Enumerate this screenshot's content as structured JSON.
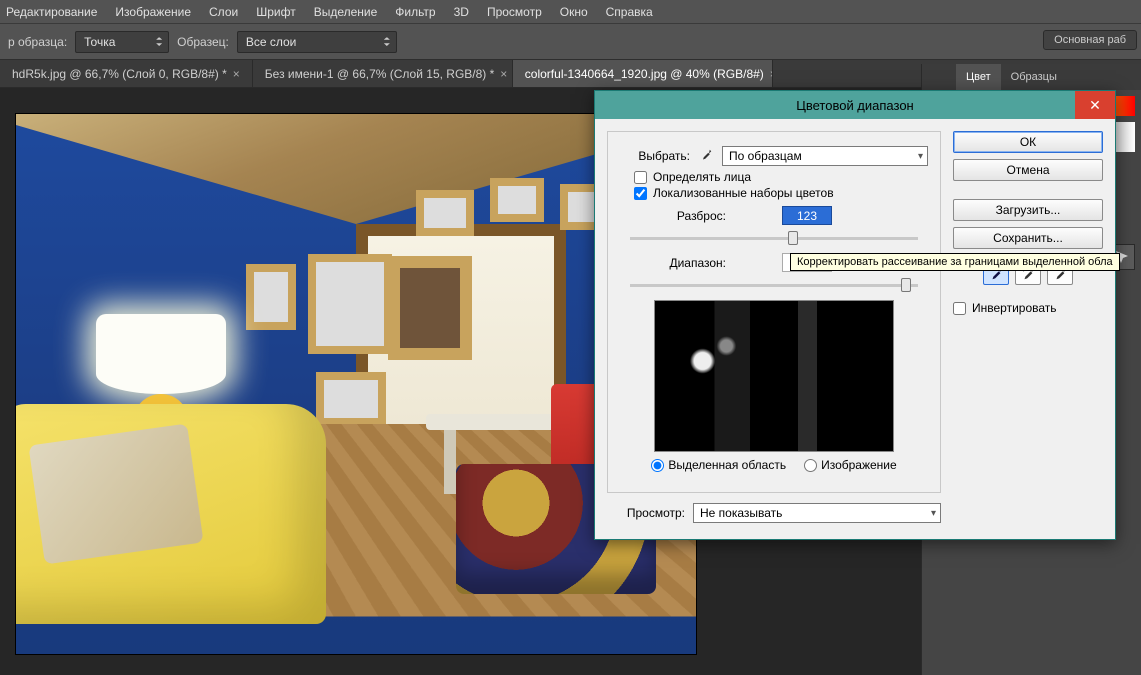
{
  "menu": {
    "items": [
      "Редактирование",
      "Изображение",
      "Слои",
      "Шрифт",
      "Выделение",
      "Фильтр",
      "3D",
      "Просмотр",
      "Окно",
      "Справка"
    ]
  },
  "options": {
    "sample_label": "р образца:",
    "sample_value": "Точка",
    "sample_from_label": "Образец:",
    "sample_from_value": "Все слои",
    "right_button": "Основная раб"
  },
  "tabs": [
    {
      "label": "hdR5k.jpg @ 66,7% (Слой 0, RGB/8#) *",
      "active": false
    },
    {
      "label": "Без имени-1 @ 66,7% (Слой 15, RGB/8) *",
      "active": false
    },
    {
      "label": "colorful-1340664_1920.jpg @ 40% (RGB/8#)",
      "active": true
    }
  ],
  "rightpanel": {
    "tabs": [
      "Цвет",
      "Образцы"
    ]
  },
  "dialog": {
    "title": "Цветовой диапазон",
    "select_label": "Выбрать:",
    "select_value": "По образцам",
    "detect_faces": "Определять лица",
    "localized": "Локализованные наборы цветов",
    "fuzziness_label": "Разброс:",
    "fuzziness_value": "123",
    "range_label": "Диапазон:",
    "range_value": "",
    "radio_selection": "Выделенная область",
    "radio_image": "Изображение",
    "preview_label": "Просмотр:",
    "preview_value": "Не показывать",
    "ok": "ОК",
    "cancel": "Отмена",
    "load": "Загрузить...",
    "save": "Сохранить...",
    "invert": "Инвертировать"
  },
  "tooltip": "Корректировать рассеивание за границами выделенной обла"
}
